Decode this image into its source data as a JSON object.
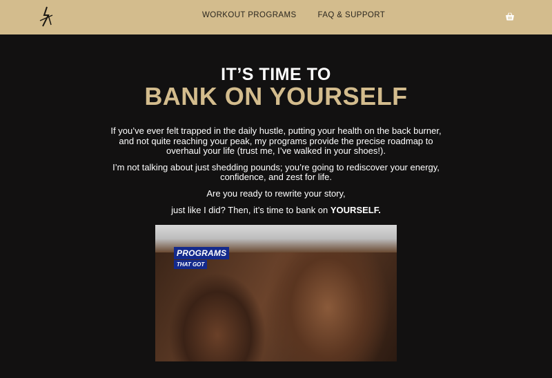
{
  "header": {
    "logo_icon": "signature-logo-icon",
    "nav": [
      {
        "label": "WORKOUT PROGRAMS"
      },
      {
        "label": "FAQ & SUPPORT"
      }
    ],
    "cart_icon": "shopping-basket-icon",
    "background_color": "#d3bc8d"
  },
  "hero": {
    "title_line1": "IT’S TIME TO",
    "title_line2": "BANK ON YOURSELF",
    "accent_color": "#d3bc8d",
    "paragraph1": "If you’ve ever felt trapped in the daily hustle, putting your health on the back burner, and not quite reaching your peak, my programs provide the precise roadmap to overhaul your life (trust me, I’ve walked in your shoes!).",
    "paragraph2": "I’m not talking about just shedding pounds; you’re going to rediscover your energy, confidence, and zest for life.",
    "question1": "Are you ready to rewrite your story,",
    "question2_prefix": "just like I did? Then, it’s time to bank on ",
    "question2_emphasis": "YOURSELF."
  },
  "video": {
    "badge_line1": "PROGRAMS",
    "badge_line2": "THAT GOT"
  }
}
